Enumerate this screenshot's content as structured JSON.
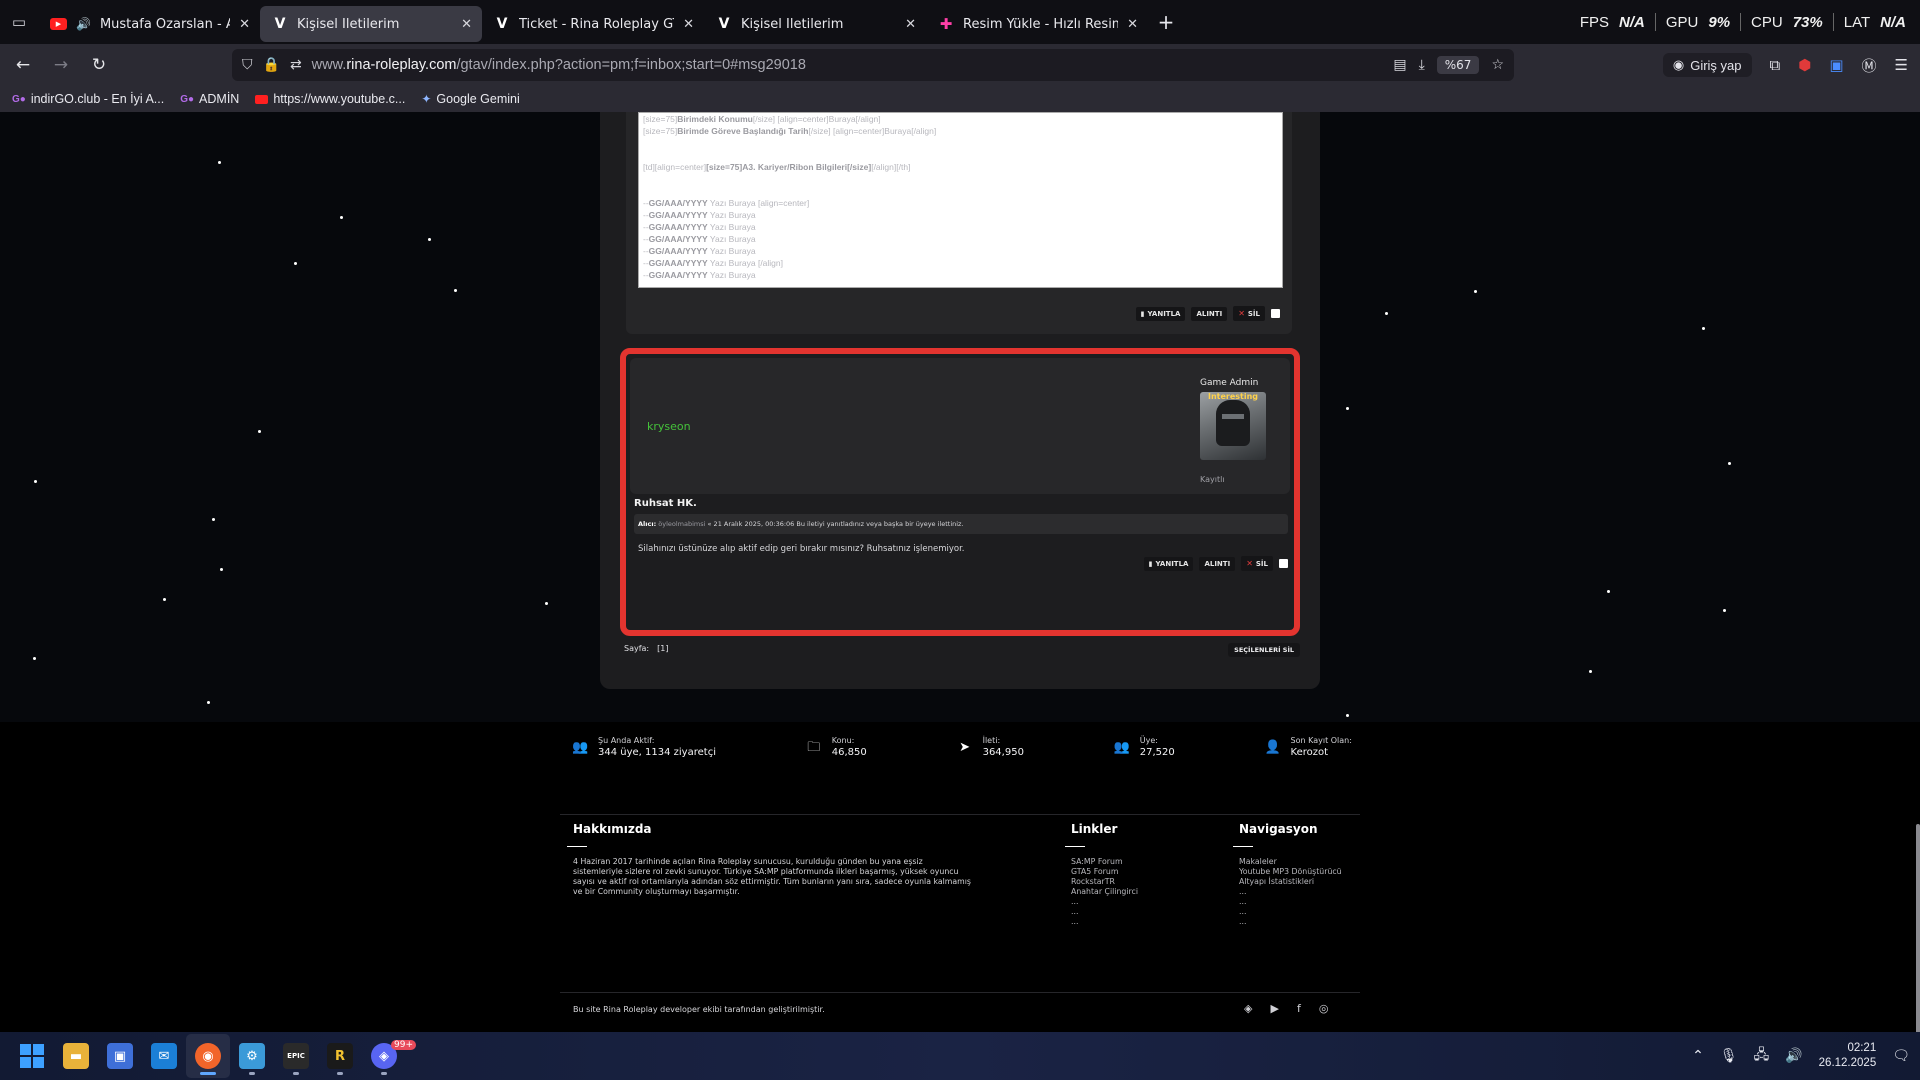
{
  "tabs": [
    {
      "title": "Mustafa Özarslan - Arayı Açma",
      "favicon": "youtube-icon",
      "audio": true,
      "active": false
    },
    {
      "title": "Kişisel İletilerim",
      "favicon": "rina-v-icon",
      "active": true
    },
    {
      "title": "Ticket - Rina Roleplay GTA V | w",
      "favicon": "rina-v-icon",
      "active": false
    },
    {
      "title": "Kişisel İletilerim",
      "favicon": "rina-v-icon",
      "active": false
    },
    {
      "title": "Resim Yükle - Hızlı Resim Paylaş",
      "favicon": "image-upload-icon",
      "active": false
    }
  ],
  "hud": {
    "fps_label": "FPS",
    "fps_val": "N/A",
    "gpu_label": "GPU",
    "gpu_val": "9%",
    "cpu_label": "CPU",
    "cpu_val": "73%",
    "lat_label": "LAT",
    "lat_val": "N/A"
  },
  "url": {
    "prefix": "www.",
    "host": "rina-roleplay.com",
    "path": "/gtav/index.php?action=pm;f=inbox;start=0#msg29018",
    "zoom": "%67"
  },
  "login_label": "Giriş yap",
  "bookmarks": [
    "indirGO.club - En İyi A...",
    "ADMİN",
    "https://www.youtube.c...",
    "Google Gemini"
  ],
  "post1": {
    "code_lines": [
      {
        "pre": "[size=75]",
        "bold": "Birimdeki Konumu",
        "post": "[/size]                      [align=center]Buraya[/align]"
      },
      {
        "pre": "[size=75]",
        "bold": "Birimde Göreve Başlandığı Tarih",
        "post": "[/size] [align=center]Buraya[/align]"
      },
      {
        "pre": "",
        "bold": "",
        "post": ""
      },
      {
        "pre": "",
        "bold": "",
        "post": ""
      },
      {
        "pre": "[td][align=center]",
        "bold": "[size=75]A3. Kariyer/Ribon Bilgileri[/size]",
        "post": "[/align][/th]"
      },
      {
        "pre": "",
        "bold": "",
        "post": ""
      },
      {
        "pre": "",
        "bold": "",
        "post": ""
      },
      {
        "pre": "--",
        "bold": "GG/AAA/YYYY",
        "post": " Yazı Buraya [align=center]"
      },
      {
        "pre": "--",
        "bold": "GG/AAA/YYYY",
        "post": " Yazı Buraya"
      },
      {
        "pre": "--",
        "bold": "GG/AAA/YYYY",
        "post": " Yazı Buraya"
      },
      {
        "pre": "--",
        "bold": "GG/AAA/YYYY",
        "post": " Yazı Buraya"
      },
      {
        "pre": "--",
        "bold": "GG/AAA/YYYY",
        "post": " Yazı Buraya"
      },
      {
        "pre": "--",
        "bold": "GG/AAA/YYYY",
        "post": " Yazı Buraya [/align]"
      },
      {
        "pre": "--",
        "bold": "GG/AAA/YYYY",
        "post": " Yazı Buraya"
      }
    ]
  },
  "actions": {
    "reply": "YANITLA",
    "quote": "ALINTI",
    "delete": "SİL"
  },
  "post2": {
    "username": "kryseon",
    "rank": "Game Admin",
    "avatar_caption": "Interesting",
    "status": "Kayıtlı",
    "subject": "Ruhsat HK.",
    "quote_label": "Alıcı:",
    "quote_recipient": "öyleolmabimsi",
    "quote_text": "« 21 Aralık 2025, 00:36:06 Bu iletiyi yanıtladınız veya başka bir üyeye ilettiniz.",
    "body": "Silahınızı üstünüze alıp aktif edip geri bırakır mısınız? Ruhsatınız işlenemiyor."
  },
  "pager": {
    "label": "Sayfa:",
    "current": "[1]"
  },
  "selected_button": "SEÇİLENLERİ SİL",
  "stats": [
    {
      "icon": "users-icon",
      "label": "Şu Anda Aktif:",
      "value": "344 üye, 1134 ziyaretçi"
    },
    {
      "icon": "folder-icon",
      "label": "Konu:",
      "value": "46,850"
    },
    {
      "icon": "send-icon",
      "label": "İleti:",
      "value": "364,950"
    },
    {
      "icon": "members-icon",
      "label": "Üye:",
      "value": "27,520"
    },
    {
      "icon": "add-user-icon",
      "label": "Son Kayıt Olan:",
      "value": "Kerozot"
    }
  ],
  "about": {
    "title": "Hakkımızda",
    "text": "4 Haziran 2017 tarihinde açılan Rina Roleplay sunucusu, kurulduğu günden bu yana eşsiz sistemleriyle sizlere rol zevki sunuyor. Türkiye SA:MP platformunda ilkleri başarmış, yüksek oyuncu sayısı ve aktif rol ortamlarıyla adından söz ettirmiştir. Tüm bunların yanı sıra, sadece oyunla kalmamış ve bir Community oluşturmayı başarmıştır."
  },
  "links": {
    "title": "Linkler",
    "items": [
      "SA:MP Forum",
      "GTA5 Forum",
      "RockstarTR",
      "Anahtar Çilingirci",
      "...",
      "...",
      "..."
    ]
  },
  "navigation": {
    "title": "Navigasyon",
    "items": [
      "Makaleler",
      "Youtube MP3 Dönüştürücü",
      "Altyapı İstatistikleri",
      "...",
      "...",
      "...",
      "..."
    ]
  },
  "credit": "Bu site Rina Roleplay developer ekibi tarafından geliştirilmiştir.",
  "clock": {
    "time": "02:21",
    "date": "26.12.2025"
  },
  "taskbar_badge": "99+"
}
